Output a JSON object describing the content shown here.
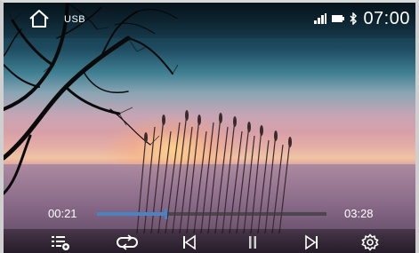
{
  "topbar": {
    "source_label": "USB",
    "clock": "07:00",
    "icons": [
      "home-icon",
      "signal-icon",
      "battery-icon",
      "bluetooth-icon"
    ]
  },
  "playback": {
    "elapsed": "00:21",
    "total": "03:28",
    "progress": 0.3
  },
  "controls": {
    "icons": [
      "playlist-icon",
      "repeat-icon",
      "previous-track-icon",
      "pause-icon",
      "next-track-icon",
      "settings-icon"
    ]
  },
  "colors": {
    "accent": "#4a83c4",
    "text": "#ffffff"
  }
}
